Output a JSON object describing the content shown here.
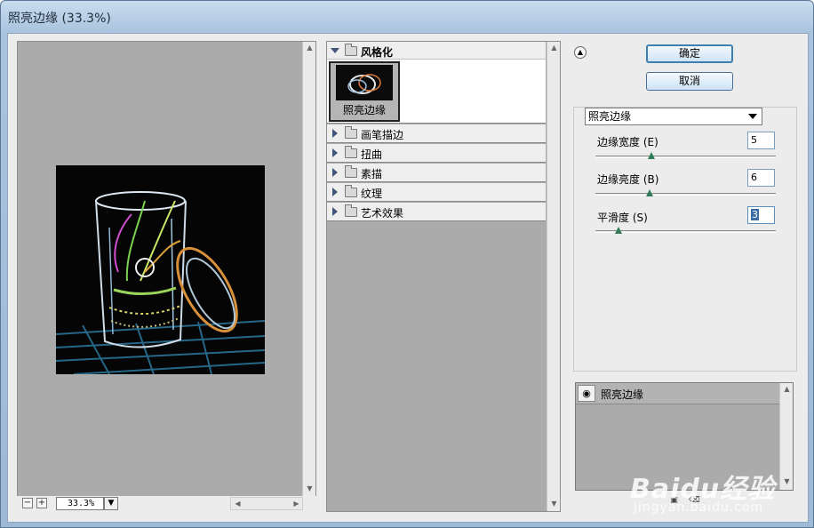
{
  "window": {
    "title": "照亮边缘 (33.3%)"
  },
  "preview": {
    "zoom_value": "33.3%"
  },
  "gallery": {
    "open_category": {
      "label": "风格化",
      "thumbnail_label": "照亮边缘"
    },
    "categories": [
      {
        "label": "画笔描边"
      },
      {
        "label": "扭曲"
      },
      {
        "label": "素描"
      },
      {
        "label": "纹理"
      },
      {
        "label": "艺术效果"
      }
    ]
  },
  "buttons": {
    "ok": "确定",
    "cancel": "取消"
  },
  "settings": {
    "selected_filter": "照亮边缘",
    "params": [
      {
        "label": "边缘宽度 (E)",
        "value": "5",
        "level": 0.31
      },
      {
        "label": "边缘亮度 (B)",
        "value": "6",
        "level": 0.3
      },
      {
        "label": "平滑度 (S)",
        "value": "3",
        "level": 0.13
      }
    ]
  },
  "layers": {
    "items": [
      {
        "label": "照亮边缘"
      }
    ]
  },
  "watermark": {
    "brand": "Baidu经验",
    "url": "jingyan.baidu.com"
  },
  "icons": {
    "collapse": "double-chevron-up-icon",
    "eye": "eye-icon",
    "new_layer": "new-effect-layer-icon",
    "delete_layer": "delete-layer-icon"
  }
}
